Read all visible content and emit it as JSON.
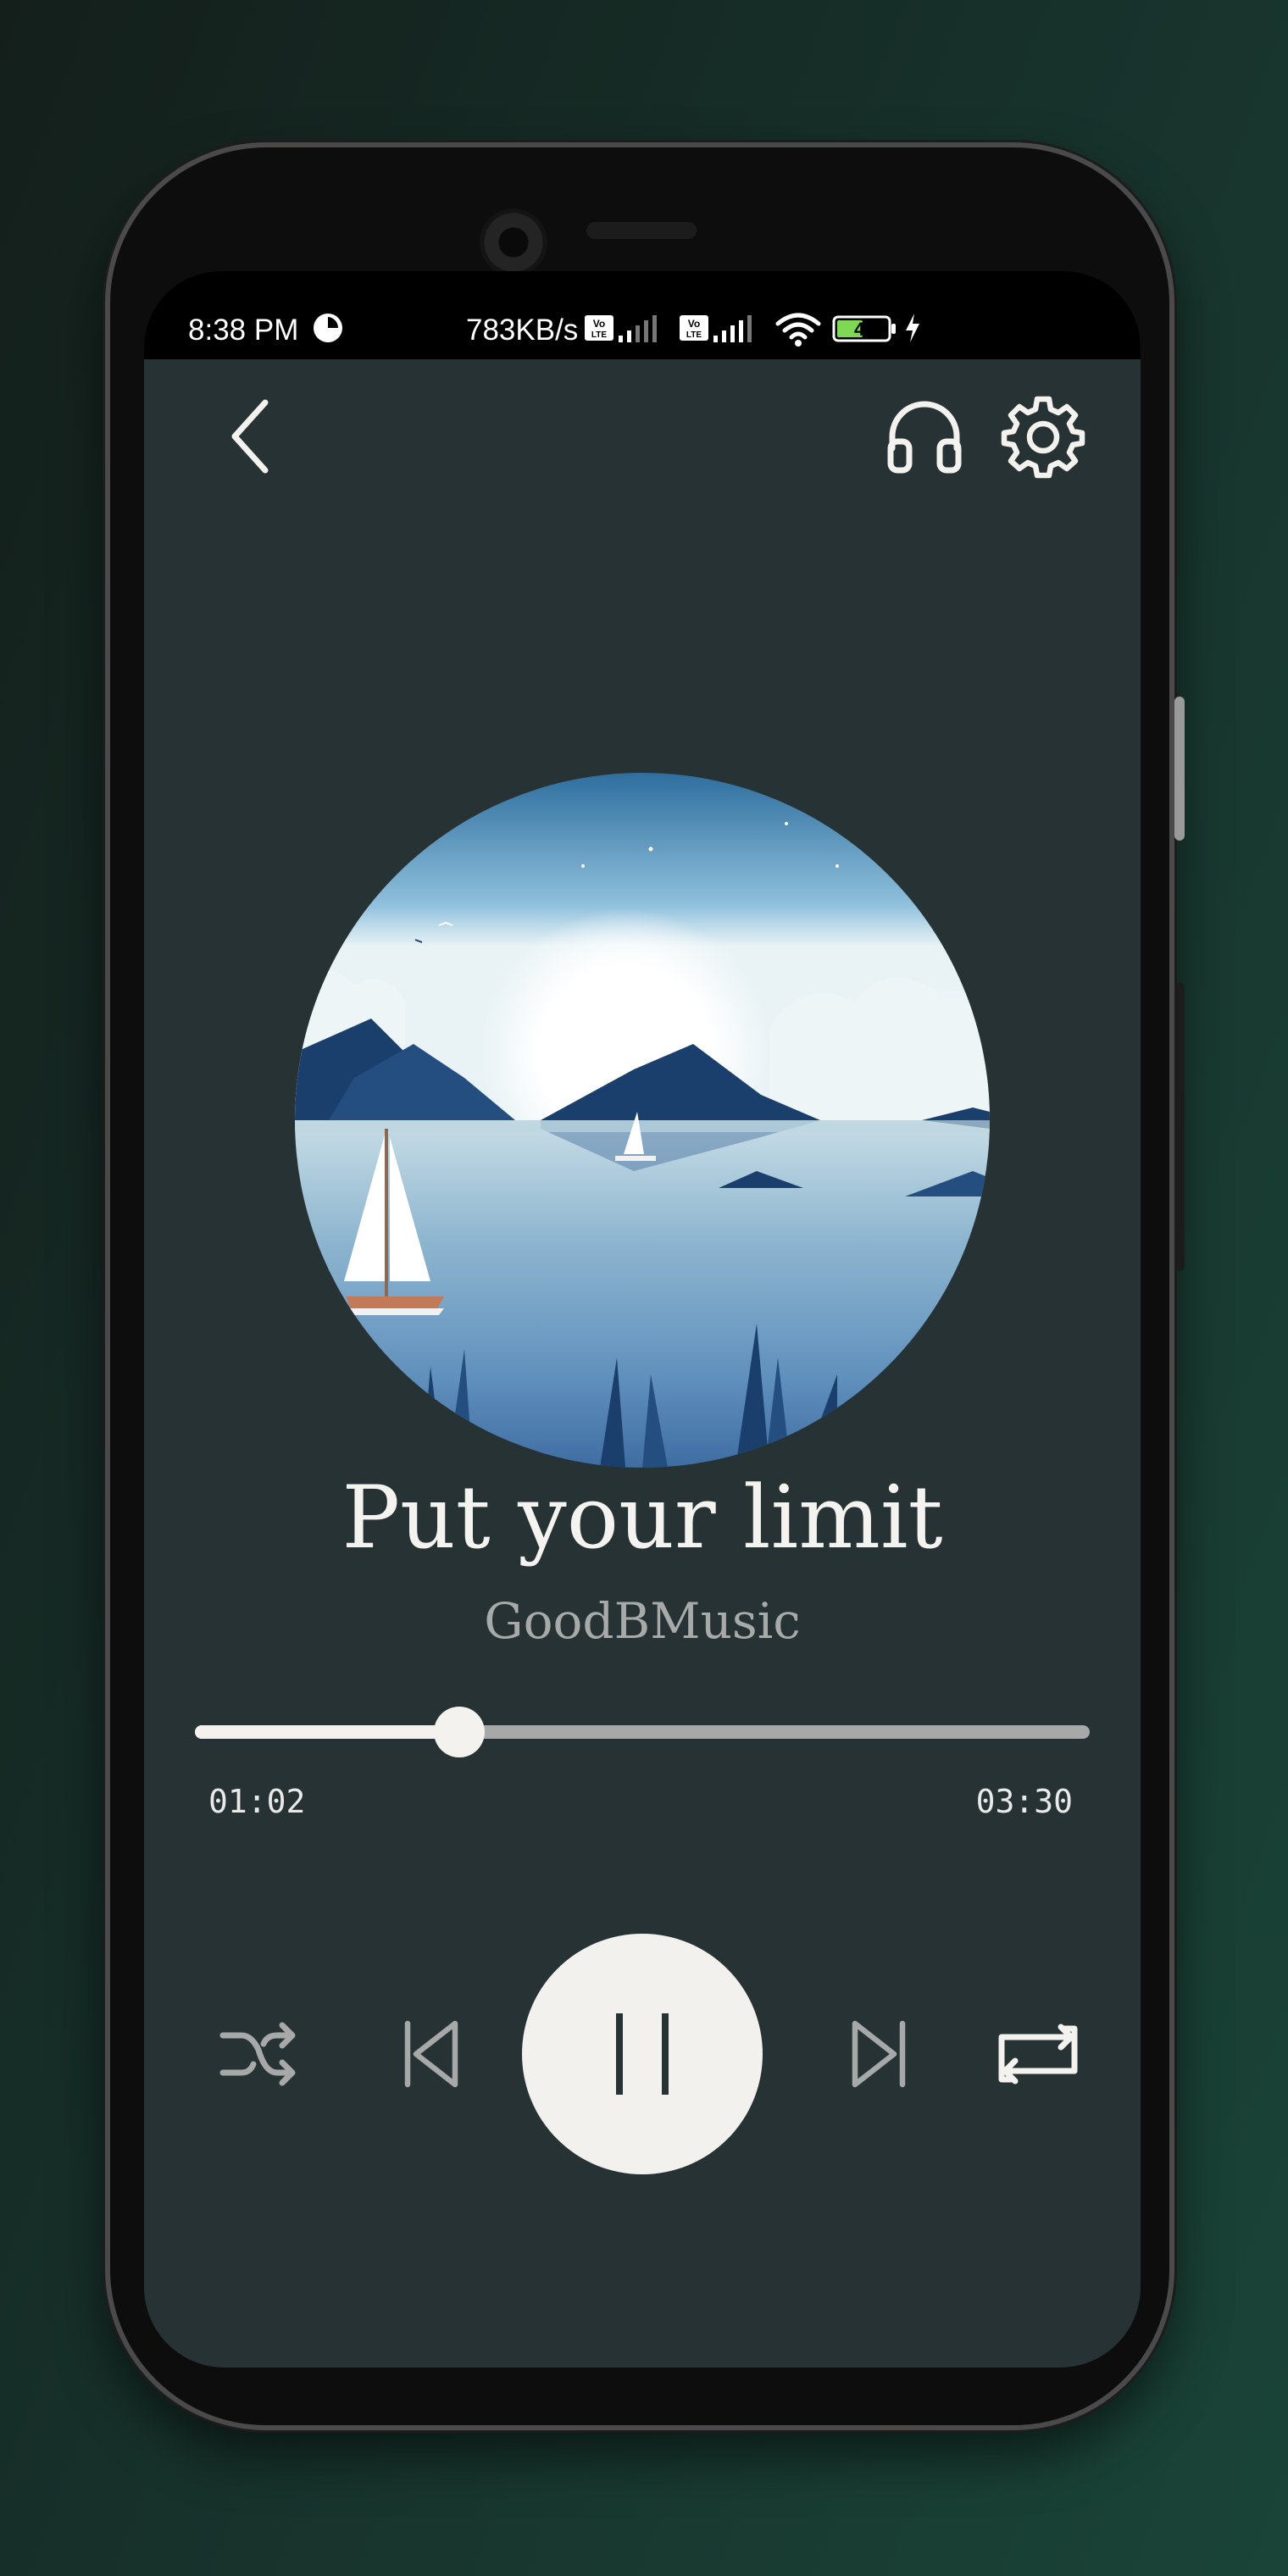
{
  "status_bar": {
    "time": "8:38 PM",
    "network_speed": "783KB/s",
    "battery": "44"
  },
  "header": {
    "back_icon": "chevron-left-icon",
    "headphones_icon": "headphones-icon",
    "settings_icon": "gear-icon"
  },
  "now_playing": {
    "title": "Put your limit",
    "artist": "GoodBMusic",
    "elapsed": "01:02",
    "duration": "03:30",
    "progress": 0.295
  },
  "controls": {
    "shuffle_icon": "shuffle-icon",
    "previous_icon": "skip-previous-icon",
    "play_pause_icon": "pause-icon",
    "next_icon": "skip-next-icon",
    "repeat_icon": "repeat-icon"
  },
  "colors": {
    "screen_bg": "#263234",
    "accent": "#f4f2ee",
    "muted": "#a6a9a7"
  }
}
